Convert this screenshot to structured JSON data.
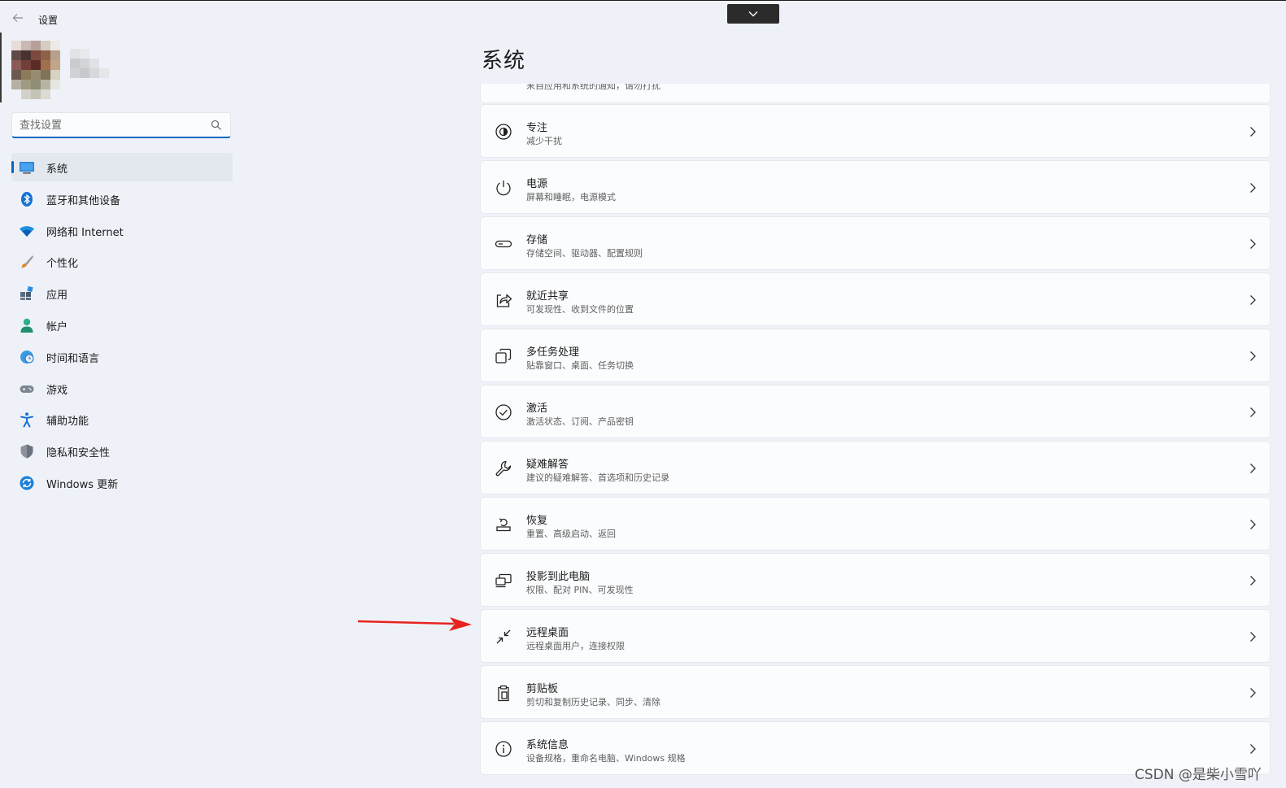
{
  "window": {
    "title": "设置"
  },
  "search": {
    "placeholder": "查找设置"
  },
  "nav": {
    "items": [
      {
        "label": "系统",
        "icon": "monitor-icon",
        "active": true
      },
      {
        "label": "蓝牙和其他设备",
        "icon": "bluetooth-icon"
      },
      {
        "label": "网络和 Internet",
        "icon": "wifi-icon"
      },
      {
        "label": "个性化",
        "icon": "brush-icon"
      },
      {
        "label": "应用",
        "icon": "apps-icon"
      },
      {
        "label": "帐户",
        "icon": "account-icon"
      },
      {
        "label": "时间和语言",
        "icon": "globe-clock-icon"
      },
      {
        "label": "游戏",
        "icon": "gamepad-icon"
      },
      {
        "label": "辅助功能",
        "icon": "accessibility-icon"
      },
      {
        "label": "隐私和安全性",
        "icon": "shield-icon"
      },
      {
        "label": "Windows 更新",
        "icon": "update-icon"
      }
    ]
  },
  "main": {
    "title": "系统",
    "partial_subtitle": "来自应用和系统的通知，请勿打扰",
    "cards": [
      {
        "title": "专注",
        "subtitle": "减少干扰",
        "icon": "focus-icon"
      },
      {
        "title": "电源",
        "subtitle": "屏幕和睡眠，电源模式",
        "icon": "power-icon"
      },
      {
        "title": "存储",
        "subtitle": "存储空间、驱动器、配置规则",
        "icon": "storage-icon"
      },
      {
        "title": "就近共享",
        "subtitle": "可发现性、收到文件的位置",
        "icon": "share-icon"
      },
      {
        "title": "多任务处理",
        "subtitle": "贴靠窗口、桌面、任务切换",
        "icon": "multitask-icon"
      },
      {
        "title": "激活",
        "subtitle": "激活状态、订阅、产品密钥",
        "icon": "activation-icon"
      },
      {
        "title": "疑难解答",
        "subtitle": "建议的疑难解答、首选项和历史记录",
        "icon": "wrench-icon"
      },
      {
        "title": "恢复",
        "subtitle": "重置、高级启动、返回",
        "icon": "recovery-icon"
      },
      {
        "title": "投影到此电脑",
        "subtitle": "权限、配对 PIN、可发现性",
        "icon": "project-icon"
      },
      {
        "title": "远程桌面",
        "subtitle": "远程桌面用户，连接权限",
        "icon": "remote-desktop-icon"
      },
      {
        "title": "剪贴板",
        "subtitle": "剪切和复制历史记录、同步、清除",
        "icon": "clipboard-icon"
      },
      {
        "title": "系统信息",
        "subtitle": "设备规格，重命名电脑、Windows 规格",
        "icon": "info-icon"
      }
    ]
  },
  "annotation": {
    "arrow_color": "#e8231f"
  },
  "watermark": "CSDN @是柴小雪吖",
  "colors": {
    "accent": "#0067c0",
    "background": "#eef2f8",
    "card": "#fbfcfe"
  }
}
